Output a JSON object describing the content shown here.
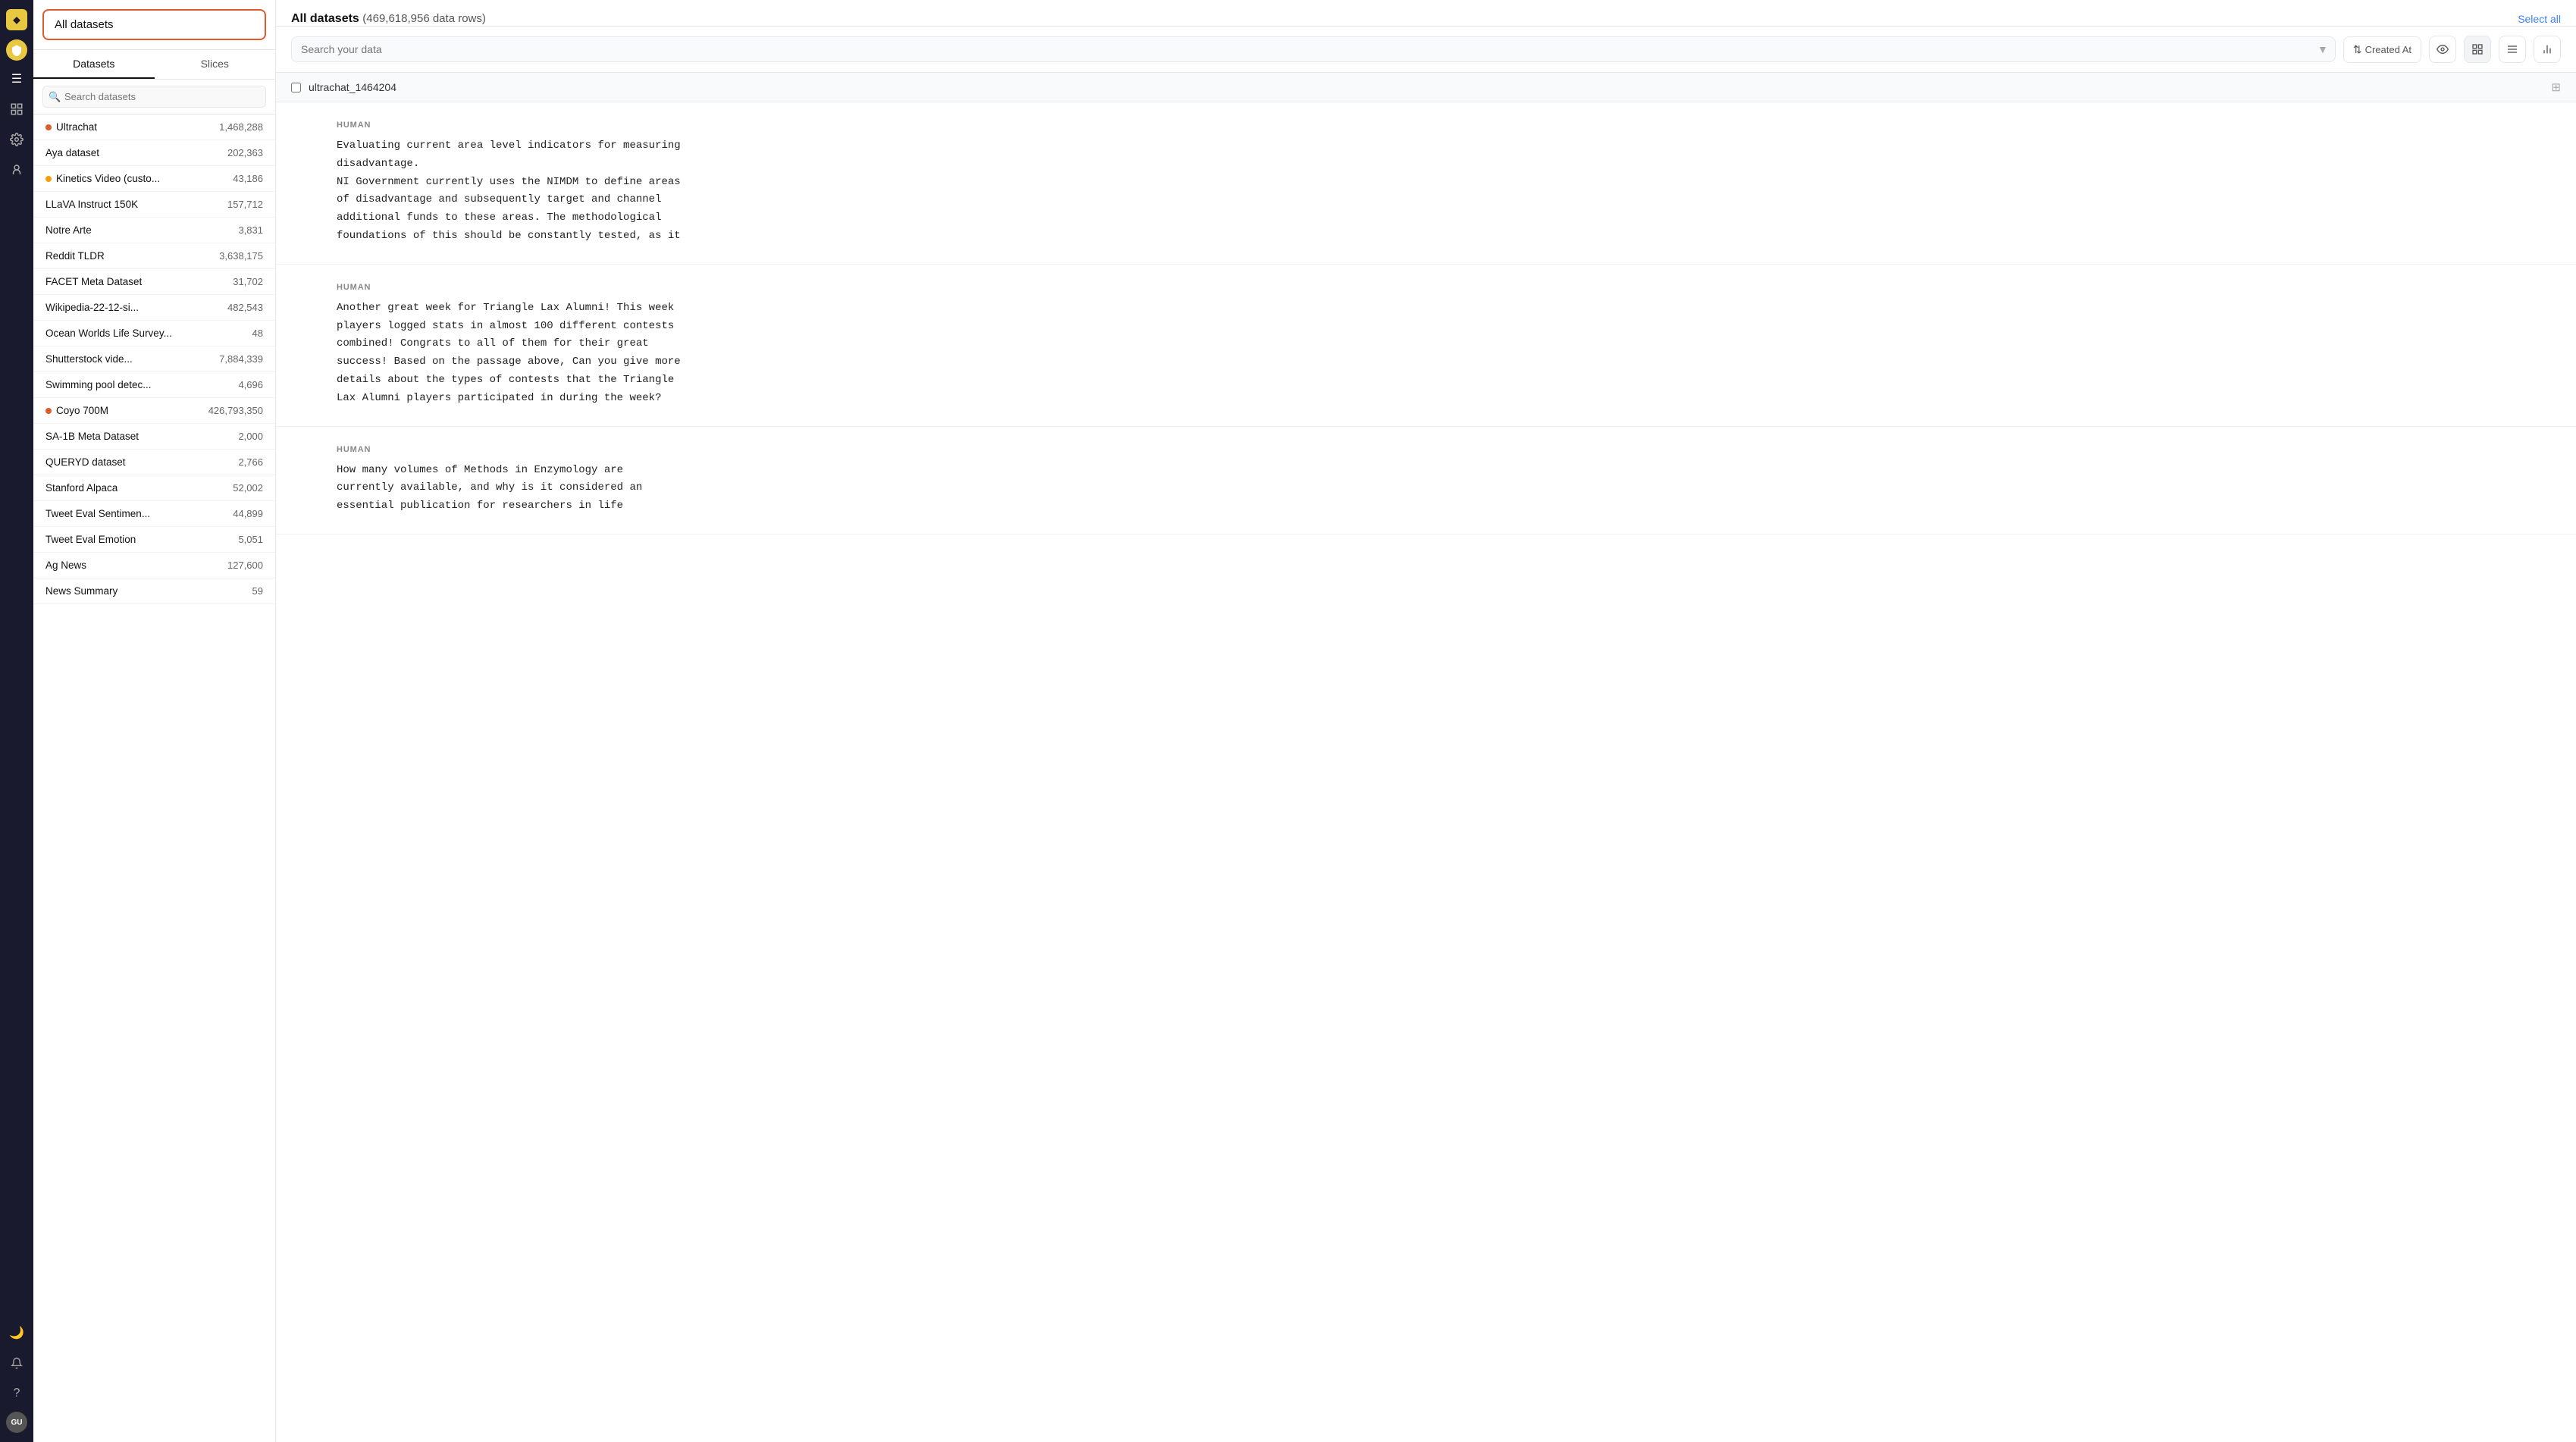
{
  "app": {
    "title": "All datasets",
    "subtitle": "(469,618,956 data rows)"
  },
  "nav": {
    "logo": "◆",
    "items": [
      {
        "icon": "☰",
        "name": "menu"
      },
      {
        "icon": "🛡",
        "name": "shield"
      },
      {
        "icon": "◈",
        "name": "datasets"
      },
      {
        "icon": "⚙",
        "name": "settings"
      },
      {
        "icon": "🤖",
        "name": "models"
      }
    ],
    "bottom": [
      {
        "icon": "🌙",
        "name": "dark-mode"
      },
      {
        "icon": "🔔",
        "name": "notifications"
      },
      {
        "icon": "?",
        "name": "help"
      },
      {
        "text": "GU",
        "name": "avatar"
      }
    ]
  },
  "sidebar": {
    "all_datasets_label": "All datasets",
    "tabs": [
      "Datasets",
      "Slices"
    ],
    "active_tab": "Datasets",
    "search_placeholder": "Search datasets",
    "datasets": [
      {
        "name": "Ultrachat",
        "count": "1,468,288",
        "dot": "red"
      },
      {
        "name": "Aya dataset",
        "count": "202,363",
        "dot": null
      },
      {
        "name": "Kinetics Video (custo...",
        "count": "43,186",
        "dot": "orange"
      },
      {
        "name": "LLaVA Instruct 150K",
        "count": "157,712",
        "dot": null
      },
      {
        "name": "Notre Arte",
        "count": "3,831",
        "dot": null
      },
      {
        "name": "Reddit TLDR",
        "count": "3,638,175",
        "dot": null
      },
      {
        "name": "FACET Meta Dataset",
        "count": "31,702",
        "dot": null
      },
      {
        "name": "Wikipedia-22-12-si...",
        "count": "482,543",
        "dot": null
      },
      {
        "name": "Ocean Worlds Life Survey...",
        "count": "48",
        "dot": null
      },
      {
        "name": "Shutterstock vide...",
        "count": "7,884,339",
        "dot": null
      },
      {
        "name": "Swimming pool detec...",
        "count": "4,696",
        "dot": null
      },
      {
        "name": "Coyo 700M",
        "count": "426,793,350",
        "dot": "red"
      },
      {
        "name": "SA-1B Meta Dataset",
        "count": "2,000",
        "dot": null
      },
      {
        "name": "QUERYD dataset",
        "count": "2,766",
        "dot": null
      },
      {
        "name": "Stanford Alpaca",
        "count": "52,002",
        "dot": null
      },
      {
        "name": "Tweet Eval Sentimen...",
        "count": "44,899",
        "dot": null
      },
      {
        "name": "Tweet Eval Emotion",
        "count": "5,051",
        "dot": null
      },
      {
        "name": "Ag News",
        "count": "127,600",
        "dot": null
      },
      {
        "name": "News Summary",
        "count": "59",
        "dot": null
      }
    ]
  },
  "toolbar": {
    "search_placeholder": "Search your data",
    "sort_label": "Created At",
    "select_all_label": "Select all"
  },
  "content": {
    "dataset_name": "ultrachat_1464204",
    "messages": [
      {
        "role": "HUMAN",
        "text": "Evaluating current area level indicators for measuring\ndisadvantage.\nNI Government currently uses the NIMDM to define areas\nof disadvantage and subsequently target and channel\nadditional funds to these areas. The methodological\nfoundations of this should be constantly tested, as it"
      },
      {
        "role": "HUMAN",
        "text": "Another great week for Triangle Lax Alumni! This week\nplayers logged stats in almost 100 different contests\ncombined! Congrats to all of them for their great\nsuccess! Based on the passage above, Can you give more\ndetails about the types of contests that the Triangle\nLax Alumni players participated in during the week?"
      },
      {
        "role": "HUMAN",
        "text": "How many volumes of Methods in Enzymology are\ncurrently available, and why is it considered an\nessential publication for researchers in life"
      }
    ]
  }
}
